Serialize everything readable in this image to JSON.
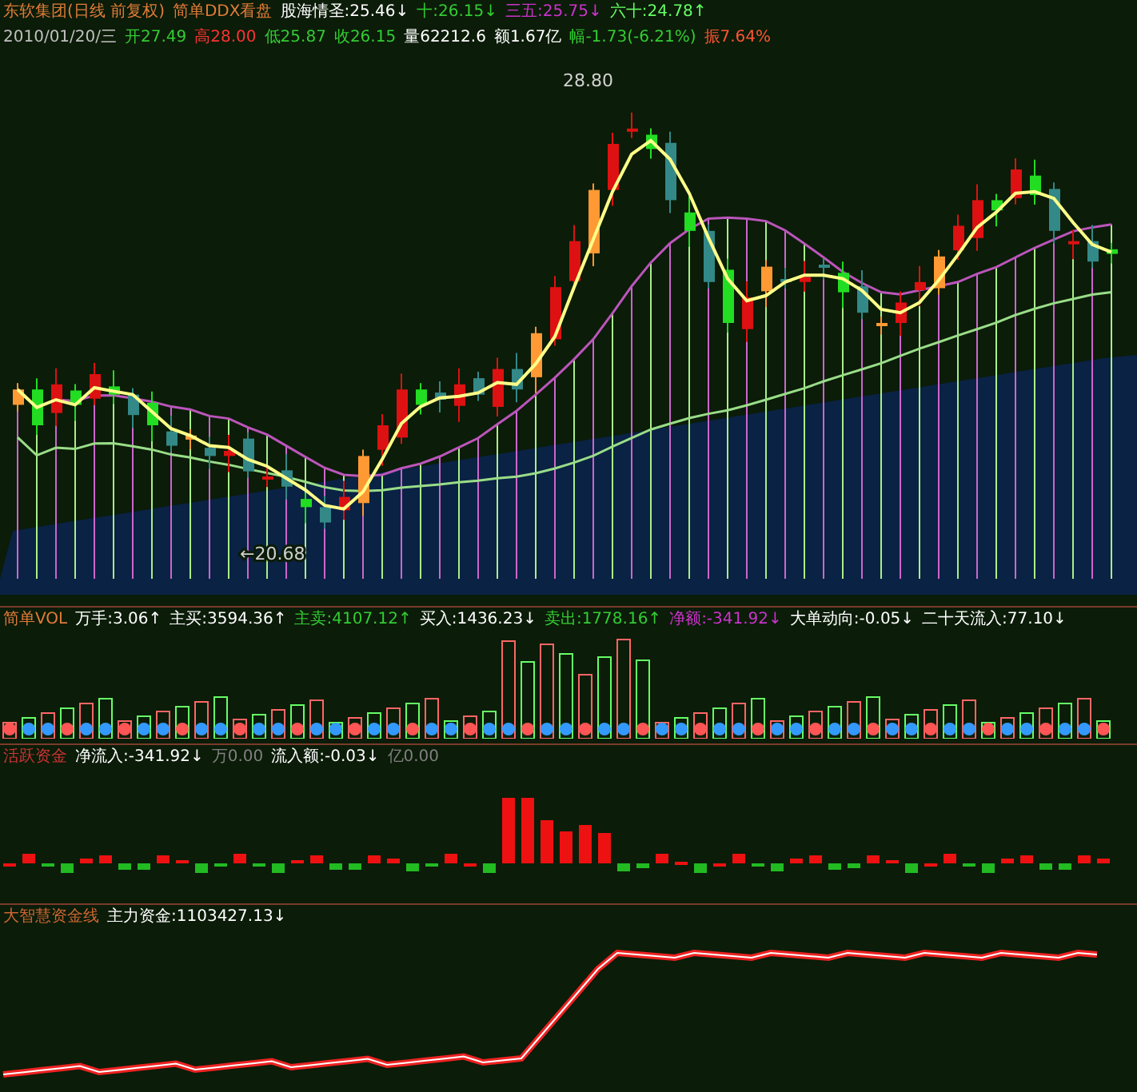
{
  "main_panel": {
    "header": [
      {
        "text": "东软集团(日线 前复权)",
        "color": "#e07b39"
      },
      {
        "text": "简单DDX看盘",
        "color": "#e07b39"
      },
      {
        "text": "股海情圣:25.46↓",
        "color": "#ffffff"
      },
      {
        "text": "十:26.15↓",
        "color": "#33cc33"
      },
      {
        "text": "三五:25.75↓",
        "color": "#cc33cc"
      },
      {
        "text": "六十:24.78↑",
        "color": "#66ff66"
      }
    ],
    "quote": [
      {
        "text": "2010/01/20/三",
        "color": "#c0c0c0"
      },
      {
        "text": "开27.49",
        "color": "#33cc33"
      },
      {
        "text": "高28.00",
        "color": "#ff3333"
      },
      {
        "text": "低25.87",
        "color": "#33cc33"
      },
      {
        "text": "收26.15",
        "color": "#33cc33"
      },
      {
        "text": "量62212.6",
        "color": "#ffffff"
      },
      {
        "text": "额1.67亿",
        "color": "#ffffff"
      },
      {
        "text": "幅-1.73(-6.21%)",
        "color": "#33cc33"
      },
      {
        "text": "振7.64%",
        "color": "#ff5533"
      }
    ],
    "high_label": "28.80",
    "low_label": "←20.68"
  },
  "vol_panel": {
    "header": [
      {
        "text": "简单VOL",
        "color": "#e07b39"
      },
      {
        "text": "万手:3.06↑",
        "color": "#ffffff"
      },
      {
        "text": "主买:3594.36↑",
        "color": "#ffffff"
      },
      {
        "text": "主卖:4107.12↑",
        "color": "#33cc33"
      },
      {
        "text": "买入:1436.23↓",
        "color": "#ffffff"
      },
      {
        "text": "卖出:1778.16↑",
        "color": "#33cc33"
      },
      {
        "text": "净额:-341.92↓",
        "color": "#cc33cc"
      },
      {
        "text": "大单动向:-0.05↓",
        "color": "#ffffff"
      },
      {
        "text": "二十天流入:77.10↓",
        "color": "#ffffff"
      }
    ]
  },
  "active_funds_panel": {
    "header": [
      {
        "text": "活跃资金",
        "color": "#cc3333"
      },
      {
        "text": "净流入:-341.92↓",
        "color": "#ffffff"
      },
      {
        "text": "万0.00",
        "color": "#808080"
      },
      {
        "text": "流入额:-0.03↓",
        "color": "#ffffff"
      },
      {
        "text": "亿0.00",
        "color": "#808080"
      }
    ]
  },
  "fund_line_panel": {
    "header": [
      {
        "text": "大智慧资金线",
        "color": "#cc6633"
      },
      {
        "text": "主力资金:1103427.13↓",
        "color": "#ffffff"
      }
    ]
  }
}
